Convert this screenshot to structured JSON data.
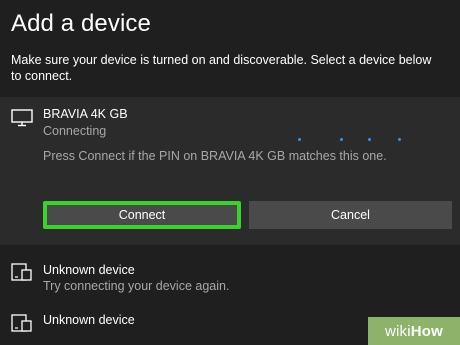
{
  "dialog": {
    "title": "Add a device",
    "subtitle": "Make sure your device is turned on and discoverable. Select a device below to connect."
  },
  "selected_device": {
    "icon": "monitor-icon",
    "name": "BRAVIA 4K GB",
    "status": "Connecting",
    "message": "Press Connect if the PIN on BRAVIA 4K GB matches this one.",
    "connect_label": "Connect",
    "cancel_label": "Cancel"
  },
  "devices": [
    {
      "icon": "tablet-phone-icon",
      "name": "Unknown device",
      "status": "Try connecting your device again."
    },
    {
      "icon": "tablet-phone-icon",
      "name": "Unknown device",
      "status": ""
    }
  ],
  "colors": {
    "background": "#1f1f1f",
    "selected_panel": "#2b2b2b",
    "button": "#4a4a4a",
    "highlight": "#39d32b",
    "progress": "#3b8eea",
    "watermark": "#8fb26a"
  },
  "watermark": {
    "part1": "wiki",
    "part2": "How"
  }
}
